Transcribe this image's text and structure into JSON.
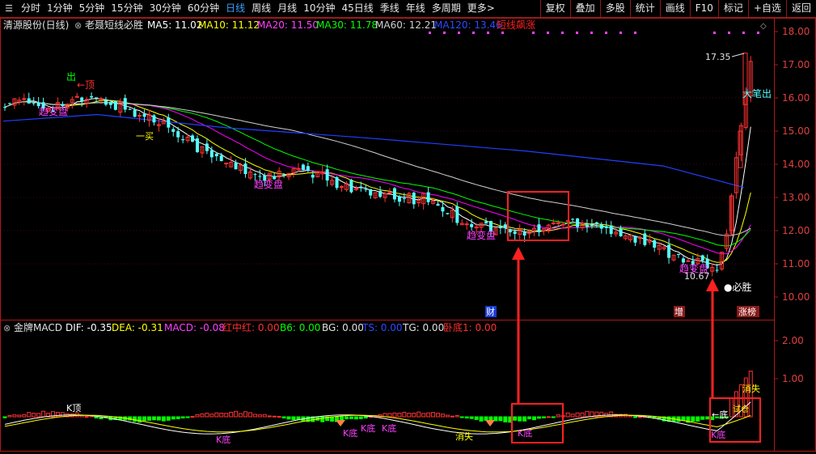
{
  "toolbar": {
    "periods": [
      "分时",
      "1分钟",
      "5分钟",
      "15分钟",
      "30分钟",
      "60分钟",
      "日线",
      "周线",
      "月线",
      "10分钟",
      "45日线",
      "季线",
      "年线",
      "多周期",
      "更多>"
    ],
    "active": "日线",
    "actions": [
      "复权",
      "叠加",
      "多股",
      "统计",
      "画线",
      "F10",
      "标记",
      "+自选",
      "返回"
    ]
  },
  "main_header": {
    "stock": "清源股份(日线)",
    "formula": "老聂短线必胜",
    "ma5": "MA5: 11.02",
    "ma10": "MA10: 11.12",
    "ma20": "MA20: 11.50",
    "ma30": "MA30: 11.78",
    "ma60": "MA60: 12.21",
    "ma120": "MA120: 13.46",
    "signal": "短线飙涨"
  },
  "price_axis": [
    "18.00",
    "17.00",
    "16.00",
    "15.00",
    "14.00",
    "13.00",
    "12.00",
    "11.00",
    "10.00"
  ],
  "annotations": {
    "high_price": "17.35",
    "low_price": "10.67",
    "chu": "出",
    "ding": "←顶",
    "dabi_chu": "大笔出",
    "bisheng": "●必胜",
    "cai": "财",
    "zeng": "增",
    "zhangbang": "涨榜",
    "bianpan": [
      "趋变盘",
      "趋变盘",
      "趋变盘",
      "趋变盘"
    ],
    "upper_labels": [
      "一买"
    ]
  },
  "macd_header": {
    "name": "金牌MACD",
    "dif": "DIF: -0.35",
    "dea": "DEA: -0.31",
    "macd": "MACD: -0.08",
    "hzh": "红中红: 0.00",
    "b6": "B6: 0.00",
    "bg": "BG: 0.00",
    "ts": "TS: 0.00",
    "tg": "TG: 0.00",
    "wd": "卧底1: 0.00"
  },
  "macd_axis": [
    "2.00",
    "1.00"
  ],
  "macd_labels": {
    "k_ding": "K顶",
    "k_di": [
      "K底",
      "K底",
      "K底",
      "K底",
      "K底",
      "K底"
    ],
    "xiaoshi": [
      "消失",
      "消失"
    ],
    "di": "←底",
    "shihe": "试仓"
  },
  "colors": {
    "up": "#ff3232",
    "down": "#54ffff",
    "ma5": "#ffffff",
    "ma10": "#ffff00",
    "ma20": "#ff00ff",
    "ma30": "#00ff00",
    "ma60": "#d0d0d0",
    "ma120": "#2040ff",
    "border": "#b01818",
    "highlight": "#ff2020"
  }
}
